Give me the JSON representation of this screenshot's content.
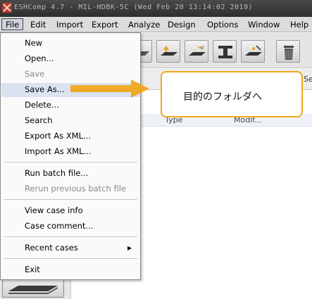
{
  "window": {
    "title": "ESHComp 4.7 - MIL-HDBK-5C (Wed Feb 20 13:14:02 2019)"
  },
  "menubar": {
    "items": [
      "File",
      "Edit",
      "Import",
      "Export",
      "Analyze",
      "Design",
      "Options",
      "Window",
      "Help"
    ],
    "active": "File"
  },
  "file_menu": {
    "items": [
      {
        "label": "New",
        "enabled": true
      },
      {
        "label": "Open...",
        "enabled": true
      },
      {
        "label": "Save",
        "enabled": false
      },
      {
        "label": "Save As...",
        "enabled": true,
        "highlighted": true
      },
      {
        "label": "Delete...",
        "enabled": true
      },
      {
        "label": "Search",
        "enabled": true
      },
      {
        "label": "Export As XML...",
        "enabled": true
      },
      {
        "label": "Import As XML...",
        "enabled": true
      },
      {
        "label": "Run batch file...",
        "enabled": true
      },
      {
        "label": "Rerun previous batch file",
        "enabled": false
      },
      {
        "label": "View case info",
        "enabled": true
      },
      {
        "label": "Case comment...",
        "enabled": true
      },
      {
        "label": "Recent cases",
        "enabled": true,
        "submenu": true
      },
      {
        "label": "Exit",
        "enabled": true
      }
    ]
  },
  "table": {
    "header_fragment": "Se",
    "row_fragments": [
      "Type",
      "Modif..."
    ]
  },
  "callout": {
    "text": "目的のフォルダへ",
    "border_color": "#f0a61e",
    "arrow_color": "#f0a61e"
  },
  "toolbar": {
    "icons": [
      "layer-plate-icon",
      "import-plate-icon",
      "cut-plate-icon",
      "ibeam-icon",
      "joint-icon",
      "trash-icon"
    ]
  }
}
